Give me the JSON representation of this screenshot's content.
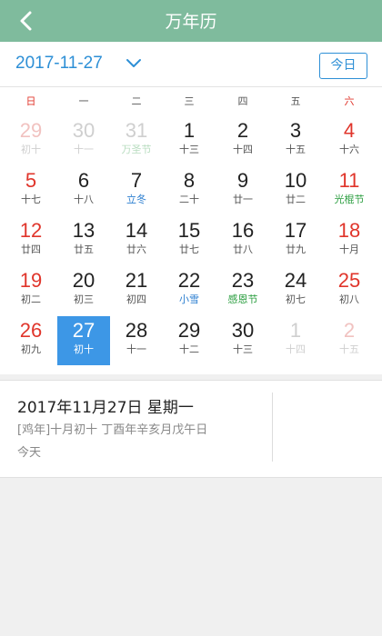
{
  "header": {
    "title": "万年历"
  },
  "datebar": {
    "date": "2017-11-27",
    "today_label": "今日"
  },
  "weekdays": [
    {
      "label": "日",
      "weekend": true
    },
    {
      "label": "一",
      "weekend": false
    },
    {
      "label": "二",
      "weekend": false
    },
    {
      "label": "三",
      "weekend": false
    },
    {
      "label": "四",
      "weekend": false
    },
    {
      "label": "五",
      "weekend": false
    },
    {
      "label": "六",
      "weekend": true
    }
  ],
  "days": [
    {
      "day": "29",
      "lunar": "初十",
      "other": true,
      "weekend": true
    },
    {
      "day": "30",
      "lunar": "十一",
      "other": true
    },
    {
      "day": "31",
      "lunar": "万圣节",
      "other": true,
      "lunar_style": "green"
    },
    {
      "day": "1",
      "lunar": "十三"
    },
    {
      "day": "2",
      "lunar": "十四"
    },
    {
      "day": "3",
      "lunar": "十五"
    },
    {
      "day": "4",
      "lunar": "十六",
      "weekend": true
    },
    {
      "day": "5",
      "lunar": "十七",
      "weekend": true
    },
    {
      "day": "6",
      "lunar": "十八"
    },
    {
      "day": "7",
      "lunar": "立冬",
      "lunar_style": "blue"
    },
    {
      "day": "8",
      "lunar": "二十"
    },
    {
      "day": "9",
      "lunar": "廿一"
    },
    {
      "day": "10",
      "lunar": "廿二"
    },
    {
      "day": "11",
      "lunar": "光棍节",
      "weekend": true,
      "lunar_style": "green"
    },
    {
      "day": "12",
      "lunar": "廿四",
      "weekend": true
    },
    {
      "day": "13",
      "lunar": "廿五"
    },
    {
      "day": "14",
      "lunar": "廿六"
    },
    {
      "day": "15",
      "lunar": "廿七"
    },
    {
      "day": "16",
      "lunar": "廿八"
    },
    {
      "day": "17",
      "lunar": "廿九"
    },
    {
      "day": "18",
      "lunar": "十月",
      "weekend": true
    },
    {
      "day": "19",
      "lunar": "初二",
      "weekend": true
    },
    {
      "day": "20",
      "lunar": "初三"
    },
    {
      "day": "21",
      "lunar": "初四"
    },
    {
      "day": "22",
      "lunar": "小雪",
      "lunar_style": "blue"
    },
    {
      "day": "23",
      "lunar": "感恩节",
      "lunar_style": "green"
    },
    {
      "day": "24",
      "lunar": "初七"
    },
    {
      "day": "25",
      "lunar": "初八",
      "weekend": true
    },
    {
      "day": "26",
      "lunar": "初九",
      "weekend": true
    },
    {
      "day": "27",
      "lunar": "初十",
      "selected": true
    },
    {
      "day": "28",
      "lunar": "十一"
    },
    {
      "day": "29",
      "lunar": "十二"
    },
    {
      "day": "30",
      "lunar": "十三"
    },
    {
      "day": "1",
      "lunar": "十四",
      "other": true
    },
    {
      "day": "2",
      "lunar": "十五",
      "other": true,
      "weekend": true
    }
  ],
  "info": {
    "date_line": "2017年11月27日  星期一",
    "lunar_line": "[鸡年]十月初十  丁酉年辛亥月戊午日",
    "today_line": "今天"
  }
}
